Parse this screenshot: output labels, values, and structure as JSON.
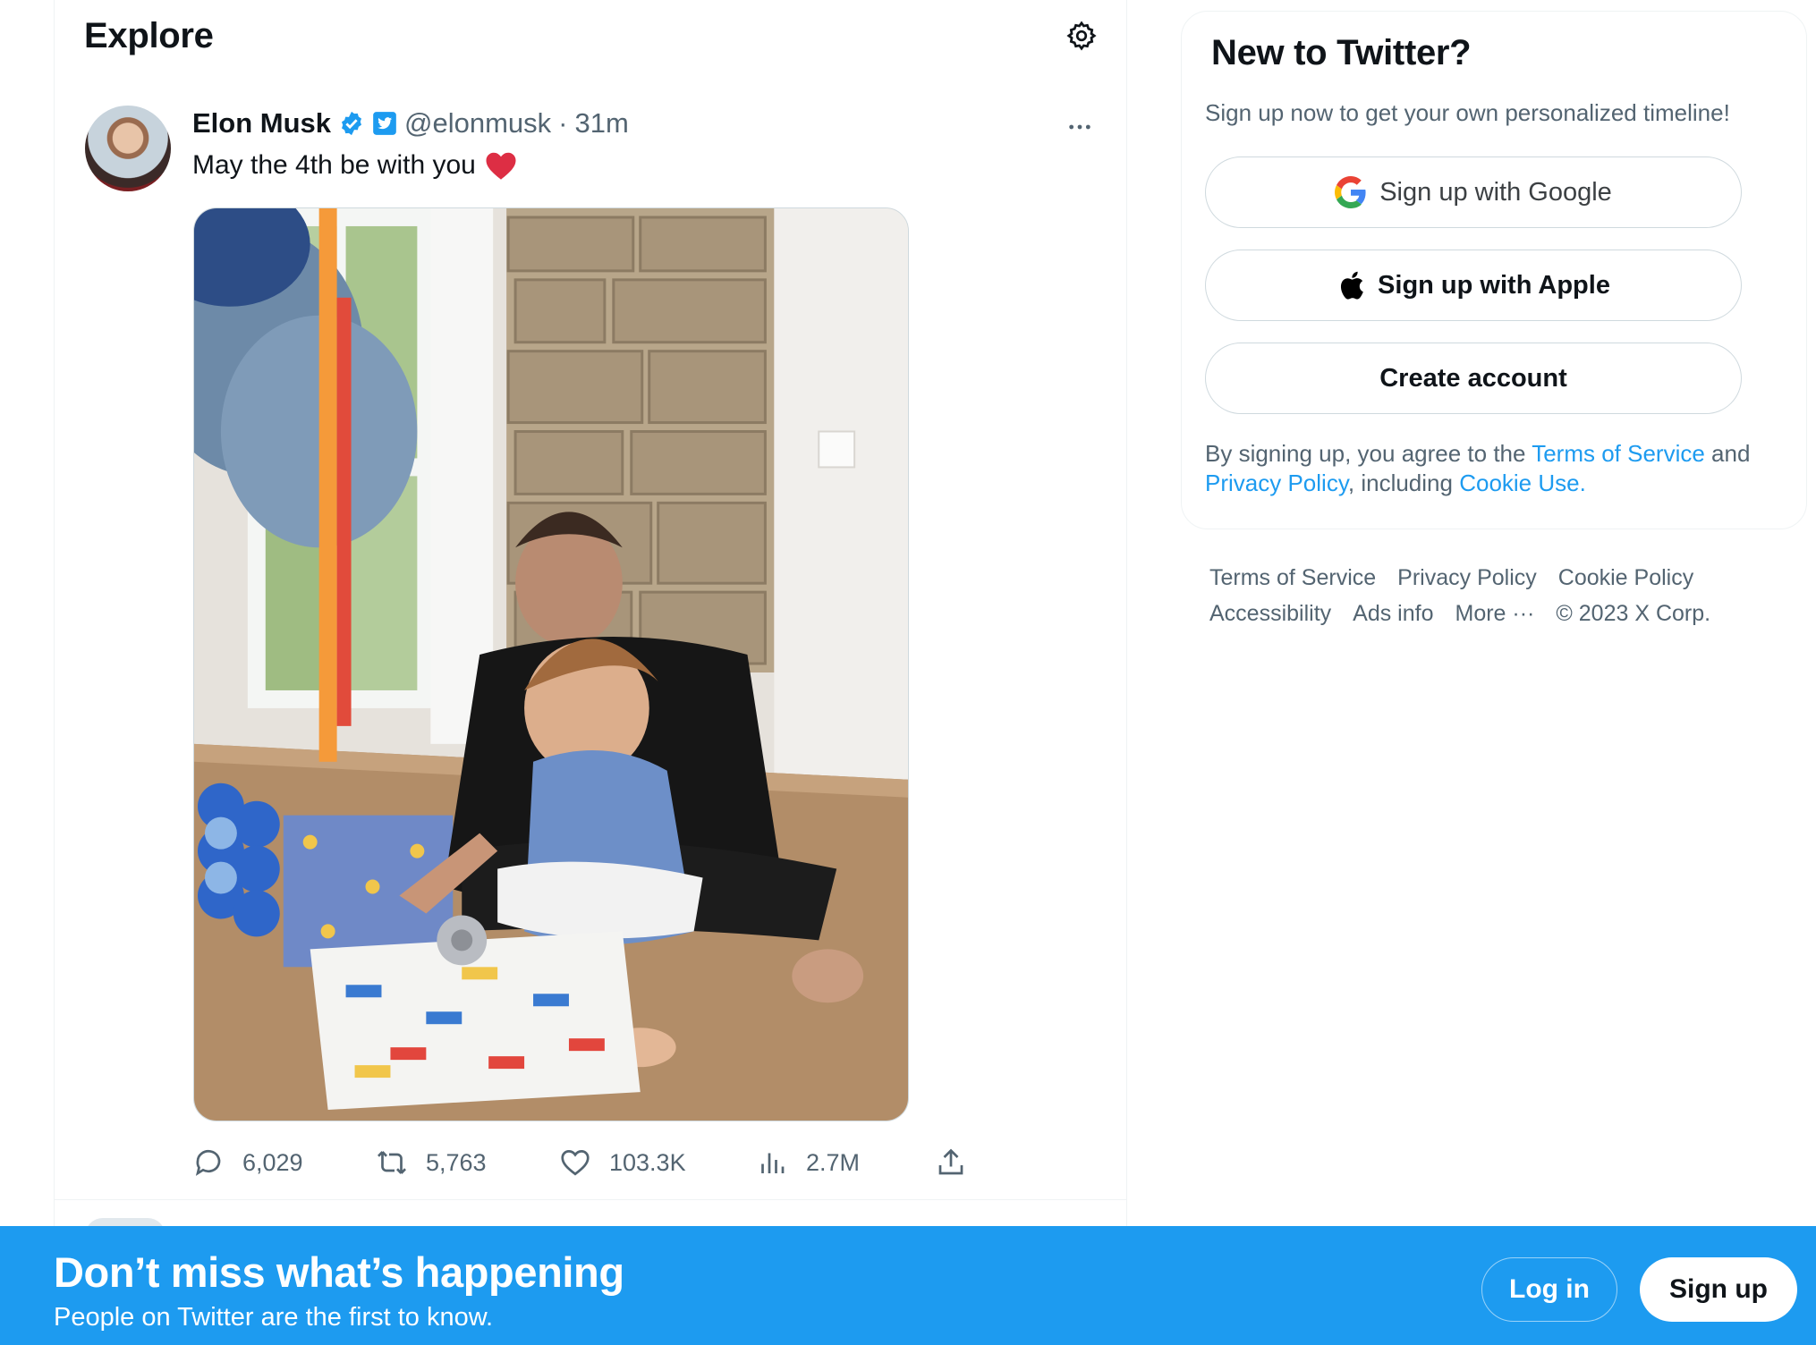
{
  "explore": {
    "title": "Explore",
    "settings_icon": "gear-icon"
  },
  "tweet": {
    "author_name": "Elon Musk",
    "verified_badge_icon": "verified-badge-icon",
    "affiliate_badge_icon": "twitter-affiliate-icon",
    "handle": "@elonmusk",
    "dot": "·",
    "time": "31m",
    "text": "May the 4th be with you",
    "emoji": "❤️",
    "media_alt": "photo",
    "stats": {
      "replies": "6,029",
      "retweets": "5,763",
      "likes": "103.3K",
      "views": "2.7M"
    }
  },
  "signup_card": {
    "title": "New to Twitter?",
    "subtitle": "Sign up now to get your own personalized timeline!",
    "google_label": "Sign up with Google",
    "apple_label": "Sign up with Apple",
    "create_label": "Create account",
    "terms_prefix": "By signing up, you agree to the ",
    "terms_link": "Terms of Service",
    "terms_and": " and ",
    "privacy_link": "Privacy Policy",
    "terms_including": ", including ",
    "cookie_link": "Cookie Use."
  },
  "footer": {
    "row1": [
      "Terms of Service",
      "Privacy Policy",
      "Cookie Policy"
    ],
    "row2": [
      "Accessibility",
      "Ads info",
      "More ···",
      "© 2023 X Corp."
    ]
  },
  "bottom_bar": {
    "title": "Don’t miss what’s happening",
    "subtitle": "People on Twitter are the first to know.",
    "login_label": "Log in",
    "signup_label": "Sign up"
  },
  "colors": {
    "accent": "#1d9bf0",
    "text_primary": "#0f1419",
    "text_secondary": "#536471",
    "heart": "#f91880"
  }
}
